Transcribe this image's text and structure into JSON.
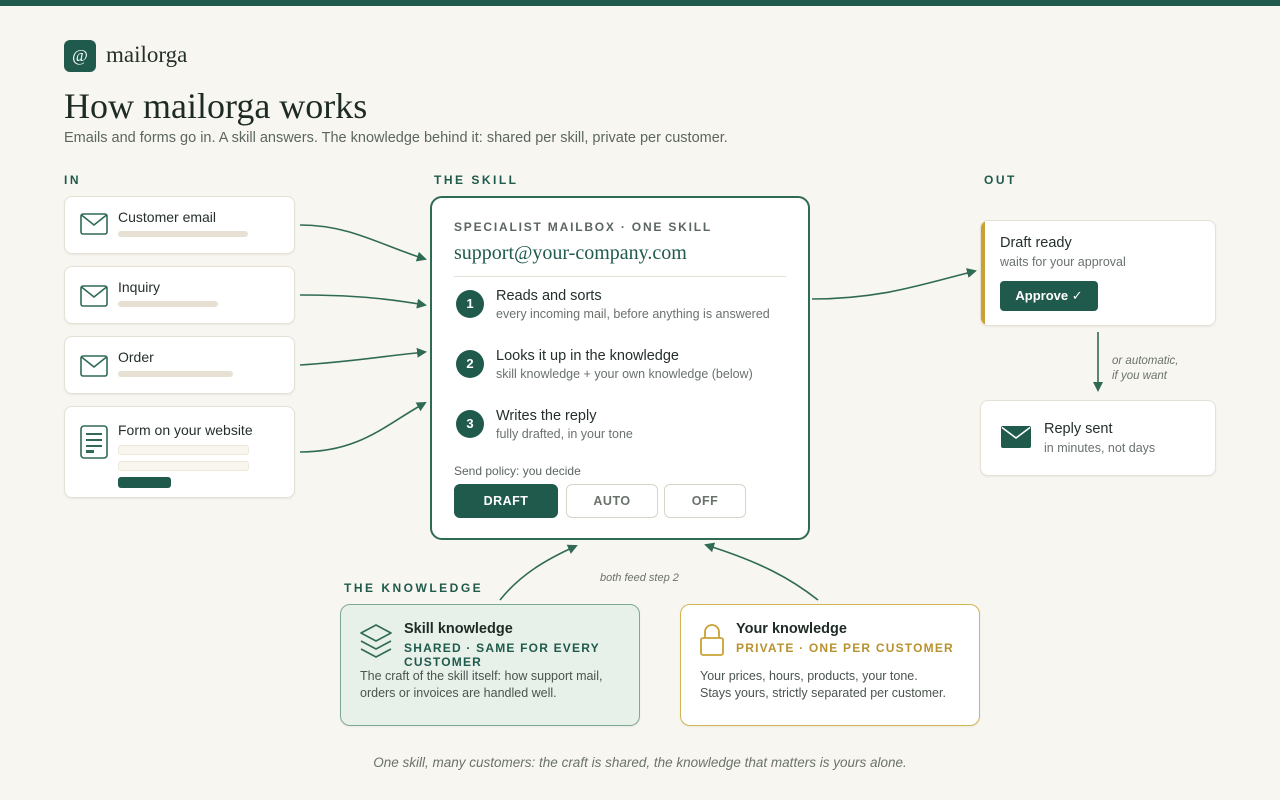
{
  "header": {
    "logo_glyph": "@",
    "logo_text": "mailorga",
    "title": "How mailorga works",
    "subtitle": "Emails and forms go in. A skill answers. The knowledge behind it: shared per skill, private per customer."
  },
  "sections": {
    "in": "IN",
    "skill": "THE SKILL",
    "out": "OUT",
    "knowledge": "THE KNOWLEDGE"
  },
  "inputs": [
    {
      "label": "Customer email",
      "icon": "envelope-icon"
    },
    {
      "label": "Inquiry",
      "icon": "envelope-icon"
    },
    {
      "label": "Order",
      "icon": "envelope-icon"
    },
    {
      "label": "Form on your website",
      "icon": "form-icon"
    }
  ],
  "skill": {
    "header": "SPECIALIST MAILBOX · ONE SKILL",
    "email": "support@your-company.com",
    "steps": [
      {
        "num": "1",
        "title": "Reads and sorts",
        "sub": "every incoming mail, before anything is answered"
      },
      {
        "num": "2",
        "title": "Looks it up in the knowledge",
        "sub": "skill knowledge + your own knowledge (below)"
      },
      {
        "num": "3",
        "title": "Writes the reply",
        "sub": "fully drafted, in your tone"
      }
    ],
    "policy_label": "Send policy: you decide",
    "policy_options": [
      "DRAFT",
      "AUTO",
      "OFF"
    ],
    "policy_selected": "DRAFT"
  },
  "outputs": {
    "draft": {
      "title": "Draft ready",
      "sub": "waits for your approval",
      "button": "Approve ✓"
    },
    "auto_note_line1": "or automatic,",
    "auto_note_line2": "if you want",
    "sent": {
      "title": "Reply sent",
      "sub": "in minutes, not days",
      "icon": "envelope-filled-icon"
    }
  },
  "knowledge": {
    "feed_note": "both feed step 2",
    "skill": {
      "title": "Skill knowledge",
      "sub": "SHARED · SAME FOR EVERY CUSTOMER",
      "desc_line1": "The craft of the skill itself: how support mail,",
      "desc_line2": "orders or invoices are handled well.",
      "icon": "layers-icon"
    },
    "yours": {
      "title": "Your knowledge",
      "sub": "PRIVATE · ONE PER CUSTOMER",
      "desc_line1": "Your prices, hours, products, your tone.",
      "desc_line2": "Stays yours, strictly separated per customer.",
      "icon": "lock-icon"
    }
  },
  "footer": "One skill, many customers: the craft is shared, the knowledge that matters is yours alone.",
  "colors": {
    "primary": "#1f5a4c",
    "accent": "#c9a235",
    "background": "#f8f6f0",
    "shared_bg": "#e8f0ea"
  }
}
